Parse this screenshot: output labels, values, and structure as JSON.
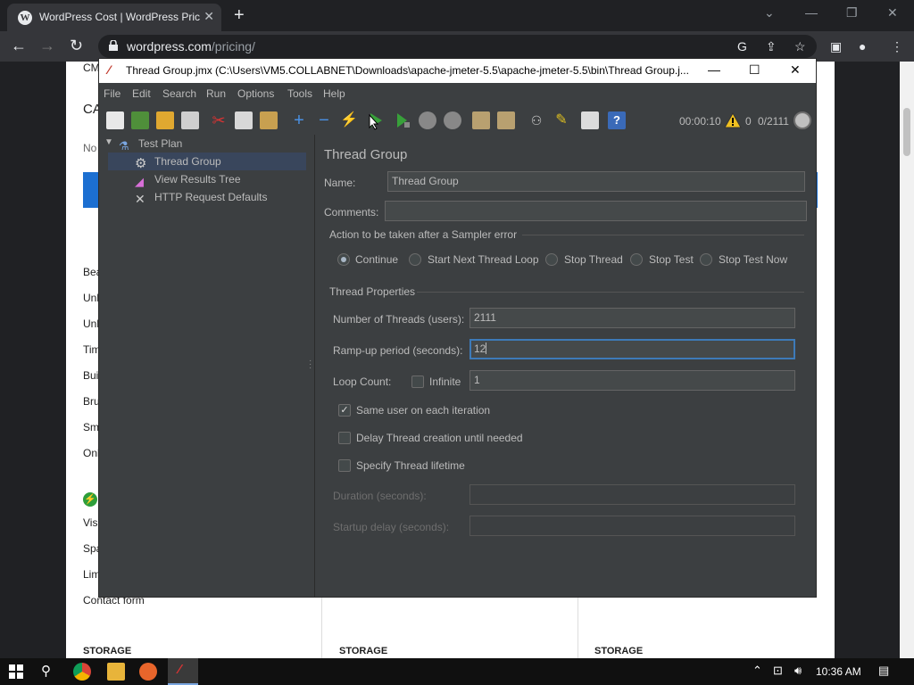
{
  "browser": {
    "tab_title": "WordPress Cost | WordPress Pric",
    "url_domain": "wordpress.com",
    "url_path": "/pricing/"
  },
  "webpage": {
    "items": [
      "CM",
      "CA",
      "No",
      "Bea",
      "Unl",
      "Unl",
      "Tim",
      "Bui",
      "Bru",
      "Sma",
      "Onl",
      "Visi",
      "Spa",
      "Lim",
      "Contact form"
    ],
    "storage_labels": [
      "STORAGE",
      "STORAGE",
      "STORAGE"
    ]
  },
  "jmeter": {
    "window_title": "Thread Group.jmx (C:\\Users\\VM5.COLLABNET\\Downloads\\apache-jmeter-5.5\\apache-jmeter-5.5\\bin\\Thread Group.j...",
    "menu": [
      {
        "label": "File"
      },
      {
        "label": "Edit"
      },
      {
        "label": "Search"
      },
      {
        "label": "Run"
      },
      {
        "label": "Options"
      },
      {
        "label": "Tools"
      },
      {
        "label": "Help"
      }
    ],
    "status": {
      "timer": "00:00:10",
      "errors": "0",
      "threads": "0/2111"
    },
    "tree": {
      "root": "Test Plan",
      "children": [
        "Thread Group",
        "View Results Tree",
        "HTTP Request Defaults"
      ]
    },
    "panel": {
      "title": "Thread Group",
      "name_label": "Name:",
      "name_value": "Thread Group",
      "comments_label": "Comments:",
      "comments_value": "",
      "sampler_error_title": "Action to be taken after a Sampler error",
      "actions": [
        "Continue",
        "Start Next Thread Loop",
        "Stop Thread",
        "Stop Test",
        "Stop Test Now"
      ],
      "selected_action": "Continue",
      "thread_props_title": "Thread Properties",
      "num_threads_label": "Number of Threads (users):",
      "num_threads_value": "2111",
      "rampup_label": "Ramp-up period (seconds):",
      "rampup_value": "12",
      "loop_label": "Loop Count:",
      "infinite_label": "Infinite",
      "loop_value": "1",
      "same_user_label": "Same user on each iteration",
      "same_user_checked": true,
      "delay_label": "Delay Thread creation until needed",
      "lifetime_label": "Specify Thread lifetime",
      "duration_label": "Duration (seconds):",
      "startup_label": "Startup delay (seconds):"
    }
  },
  "taskbar": {
    "time": "10:36 AM"
  },
  "colors": {
    "jmeter_bg": "#3c3f41",
    "field_bg": "#45494a",
    "focus_border": "#3d7ab8",
    "chrome_dark": "#202124"
  }
}
